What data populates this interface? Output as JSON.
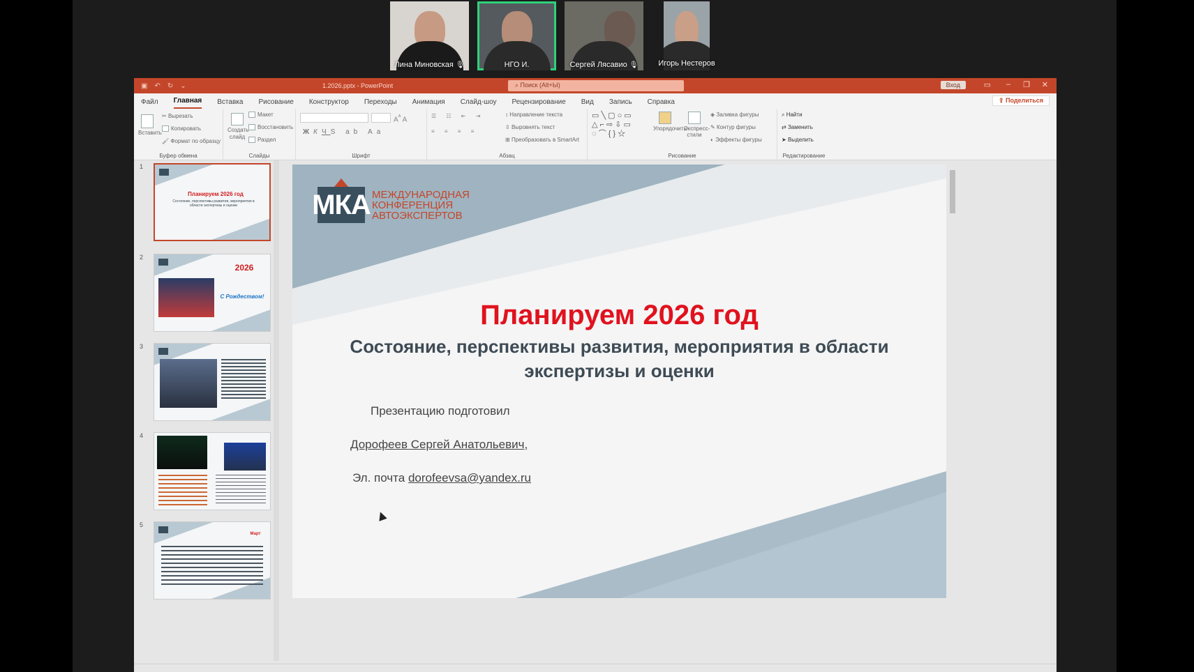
{
  "meeting": {
    "participants": [
      {
        "name": "Лина Миновская",
        "muted": true
      },
      {
        "name": "НГО И.",
        "muted": false,
        "active": true
      },
      {
        "name": "Сергей Лясавио",
        "muted": true
      },
      {
        "name": "Игорь Нестеров",
        "muted": false
      }
    ]
  },
  "app": {
    "filename": "1.2026.pptx",
    "app_name": "PowerPoint",
    "search_placeholder": "Поиск (Alt+Ы)",
    "login": "Вход",
    "share": "Поделиться",
    "accent_color": "#c4462a"
  },
  "tabs": [
    "Файл",
    "Главная",
    "Вставка",
    "Рисование",
    "Конструктор",
    "Переходы",
    "Анимация",
    "Слайд-шоу",
    "Рецензирование",
    "Вид",
    "Запись",
    "Справка"
  ],
  "ribbon": {
    "clipboard": {
      "paste": "Вставить",
      "cut": "Вырезать",
      "copy": "Копировать",
      "format": "Формат по образцу",
      "label": "Буфер обмена"
    },
    "slides": {
      "new": "Создать слайд",
      "layout": "Макет",
      "reset": "Восстановить",
      "section": "Раздел",
      "label": "Слайды"
    },
    "font": {
      "label": "Шрифт"
    },
    "paragraph": {
      "dir": "Направление текста",
      "align": "Выровнять текст",
      "smartart": "Преобразовать в SmartArt",
      "label": "Абзац"
    },
    "drawing": {
      "arrange": "Упорядочить",
      "quick": "Экспресс-стили",
      "fill": "Заливка фигуры",
      "outline": "Контур фигуры",
      "effects": "Эффекты фигуры",
      "label": "Рисование"
    },
    "editing": {
      "find": "Найти",
      "replace": "Заменить",
      "select": "Выделить",
      "label": "Редактирование"
    }
  },
  "thumbnails": [
    {
      "num": "1",
      "title": "Планируем 2026 год",
      "sub": "Состояние, перспективы развития, мероприятия в области экспертизы и оценки"
    },
    {
      "num": "2",
      "title": "2026",
      "sub": "С Рождеством!"
    },
    {
      "num": "3",
      "title": "",
      "sub": ""
    },
    {
      "num": "4",
      "title": "",
      "sub": ""
    },
    {
      "num": "5",
      "title": "Март",
      "sub": ""
    }
  ],
  "slide": {
    "logo_mark": "МКА",
    "logo_text": [
      "МЕЖДУНАРОДНАЯ",
      "КОНФЕРЕНЦИЯ",
      "АВТОЭКСПЕРТОВ"
    ],
    "title": "Планируем 2026 год",
    "subtitle": "Состояние, перспективы развития, мероприятия в области экспертизы и оценки",
    "prepared_by": "Презентацию подготовил",
    "author": "Дорофеев Сергей Анатольевич,",
    "email_label": "Эл. почта",
    "email": "dorofeevsa@yandex.ru"
  }
}
